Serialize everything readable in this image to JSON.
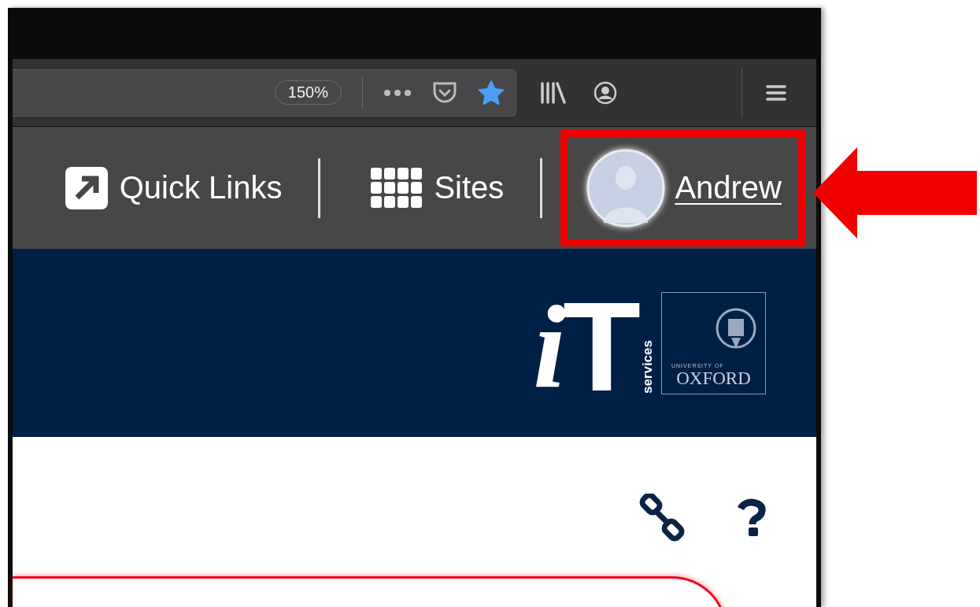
{
  "browser_toolbar": {
    "zoom": "150%",
    "bookmarked": true
  },
  "nav": {
    "quick_links": "Quick Links",
    "sites": "Sites",
    "user": "Andrew",
    "user_highlighted": true
  },
  "banner": {
    "logo_letter_i": "i",
    "logo_letter_t": "T",
    "logo_subtitle": "services",
    "crest_caption": "UNIVERSITY OF",
    "crest_name": "OXFORD"
  }
}
